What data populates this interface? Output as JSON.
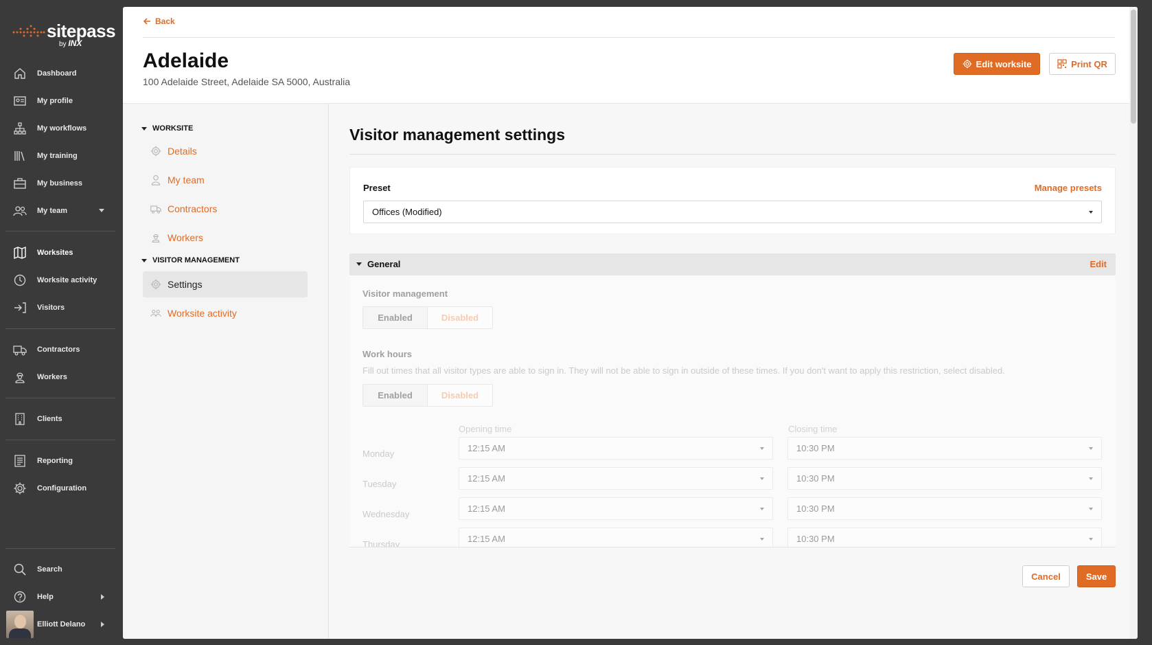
{
  "brand": {
    "name": "sitepass",
    "by": "by",
    "by_mark": "INX"
  },
  "sidebar": {
    "items": [
      {
        "label": "Dashboard",
        "icon": "home-icon"
      },
      {
        "label": "My profile",
        "icon": "id-card-icon"
      },
      {
        "label": "My workflows",
        "icon": "workflow-icon"
      },
      {
        "label": "My training",
        "icon": "books-icon"
      },
      {
        "label": "My business",
        "icon": "briefcase-icon"
      },
      {
        "label": "My team",
        "icon": "users-icon"
      },
      {
        "label": "Worksites",
        "icon": "map-icon"
      },
      {
        "label": "Worksite activity",
        "icon": "clock-icon"
      },
      {
        "label": "Visitors",
        "icon": "sign-in-icon"
      },
      {
        "label": "Contractors",
        "icon": "truck-icon"
      },
      {
        "label": "Workers",
        "icon": "worker-icon"
      },
      {
        "label": "Clients",
        "icon": "building-icon"
      },
      {
        "label": "Reporting",
        "icon": "report-icon"
      },
      {
        "label": "Configuration",
        "icon": "gear-icon"
      },
      {
        "label": "Search",
        "icon": "search-icon"
      },
      {
        "label": "Help",
        "icon": "help-icon"
      }
    ],
    "user": {
      "name": "Elliott Delano"
    }
  },
  "header": {
    "back_label": "Back",
    "title": "Adelaide",
    "address": "100 Adelaide Street, Adelaide SA 5000, Australia",
    "edit_label": "Edit worksite",
    "print_label": "Print QR"
  },
  "subnav": {
    "worksite_header": "WORKSITE",
    "worksite_items": [
      "Details",
      "My team",
      "Contractors",
      "Workers"
    ],
    "visitor_header": "VISITOR MANAGEMENT",
    "visitor_items": [
      "Settings",
      "Worksite activity"
    ]
  },
  "content": {
    "heading": "Visitor management settings",
    "preset": {
      "label": "Preset",
      "manage_label": "Manage presets",
      "value": "Offices (Modified)"
    },
    "general": {
      "title": "General",
      "edit_label": "Edit",
      "vm_label": "Visitor management",
      "enabled_label": "Enabled",
      "disabled_label": "Disabled",
      "wh_label": "Work hours",
      "wh_help": "Fill out times that all visitor types are able to sign in. They will not be able to sign in outside of these times. If you don't want to apply this restriction, select disabled.",
      "opening_label": "Opening time",
      "closing_label": "Closing time",
      "days": [
        {
          "day": "Monday",
          "open": "12:15 AM",
          "close": "10:30 PM"
        },
        {
          "day": "Tuesday",
          "open": "12:15 AM",
          "close": "10:30 PM"
        },
        {
          "day": "Wednesday",
          "open": "12:15 AM",
          "close": "10:30 PM"
        },
        {
          "day": "Thursday",
          "open": "12:15 AM",
          "close": "10:30 PM"
        }
      ]
    },
    "cancel_label": "Cancel",
    "save_label": "Save"
  },
  "colors": {
    "accent": "#e06b25",
    "sidebar": "#3a3a3a"
  }
}
